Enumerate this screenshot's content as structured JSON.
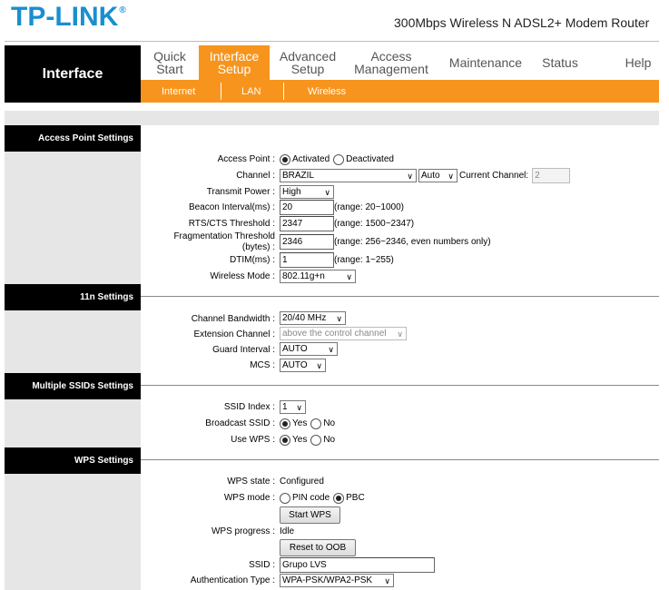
{
  "header": {
    "logo": "TP-LINK",
    "logo_mark": "®",
    "model": "300Mbps Wireless N ADSL2+ Modem Router"
  },
  "brand": "Interface",
  "nav": [
    {
      "label": "Quick\nStart",
      "l1": "Quick",
      "l2": "Start"
    },
    {
      "l1": "Interface",
      "l2": "Setup"
    },
    {
      "l1": "Advanced",
      "l2": "Setup"
    },
    {
      "l1": "Access",
      "l2": "Management"
    },
    {
      "l1": "Maintenance",
      "l2": ""
    },
    {
      "l1": "Status",
      "l2": ""
    },
    {
      "l1": "Help",
      "l2": ""
    }
  ],
  "subnav": [
    "Internet",
    "LAN",
    "Wireless"
  ],
  "sections": {
    "ap": "Access Point Settings",
    "n11": "11n Settings",
    "ssids": "Multiple SSIDs Settings",
    "wps": "WPS Settings"
  },
  "ap": {
    "access_point_label": "Access Point :",
    "activated": "Activated",
    "deactivated": "Deactivated",
    "channel_label": "Channel :",
    "channel_country": "BRAZIL",
    "channel_value": "Auto",
    "current_channel_label": "Current Channel:",
    "current_channel": "2",
    "tx_power_label": "Transmit Power :",
    "tx_power": "High",
    "beacon_label": "Beacon Interval(ms) :",
    "beacon": "20",
    "beacon_range": "(range: 20~1000)",
    "rts_label": "RTS/CTS Threshold :",
    "rts": "2347",
    "rts_range": "(range: 1500~2347)",
    "frag_label_1": "Fragmentation Threshold",
    "frag_label_2": "(bytes) :",
    "frag": "2346",
    "frag_range": "(range: 256~2346, even numbers only)",
    "dtim_label": "DTIM(ms) :",
    "dtim": "1",
    "dtim_range": "(range: 1~255)",
    "mode_label": "Wireless Mode :",
    "mode": "802.11g+n"
  },
  "n11": {
    "bw_label": "Channel Bandwidth :",
    "bw": "20/40 MHz",
    "ext_label": "Extension Channel :",
    "ext": "above the control channel",
    "guard_label": "Guard Interval :",
    "guard": "AUTO",
    "mcs_label": "MCS :",
    "mcs": "AUTO"
  },
  "ssids": {
    "index_label": "SSID Index :",
    "index": "1",
    "broadcast_label": "Broadcast SSID :",
    "use_wps_label": "Use WPS :",
    "yes": "Yes",
    "no": "No"
  },
  "wps": {
    "state_label": "WPS state :",
    "state": "Configured",
    "mode_label": "WPS mode :",
    "pin": "PIN code",
    "pbc": "PBC",
    "start": "Start WPS",
    "progress_label": "WPS progress :",
    "progress": "Idle",
    "reset": "Reset to OOB",
    "ssid_label": "SSID :",
    "ssid": "Grupo LVS",
    "auth_label": "Authentication Type :",
    "auth": "WPA-PSK/WPA2-PSK"
  }
}
